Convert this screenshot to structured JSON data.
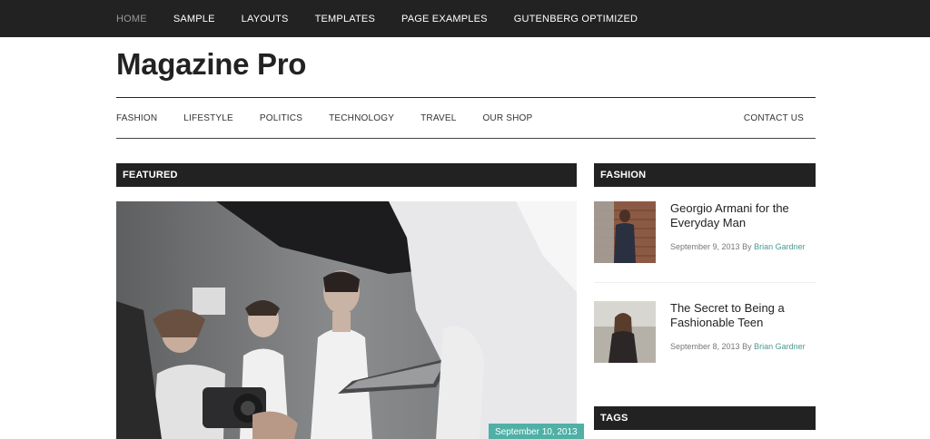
{
  "top_nav": {
    "items": [
      {
        "label": "HOME",
        "active": true
      },
      {
        "label": "SAMPLE"
      },
      {
        "label": "LAYOUTS"
      },
      {
        "label": "TEMPLATES"
      },
      {
        "label": "PAGE EXAMPLES"
      },
      {
        "label": "GUTENBERG OPTIMIZED"
      }
    ]
  },
  "site": {
    "title": "Magazine Pro"
  },
  "category_nav": {
    "items": [
      "FASHION",
      "LIFESTYLE",
      "POLITICS",
      "TECHNOLOGY",
      "TRAVEL",
      "OUR SHOP"
    ],
    "right_item": "CONTACT US"
  },
  "featured": {
    "heading": "FEATURED",
    "date": "September 10, 2013"
  },
  "sidebar": {
    "fashion_heading": "FASHION",
    "posts": [
      {
        "title": "Georgio Armani for the Everyday Man",
        "date": "September 9, 2013",
        "by": "By",
        "author": "Brian Gardner"
      },
      {
        "title": "The Secret to Being a Fashionable Teen",
        "date": "September 8, 2013",
        "by": "By",
        "author": "Brian Gardner"
      }
    ],
    "tags_heading": "TAGS"
  },
  "colors": {
    "dark": "#222222",
    "accent": "#4fb0a6",
    "link": "#4a9a92"
  }
}
